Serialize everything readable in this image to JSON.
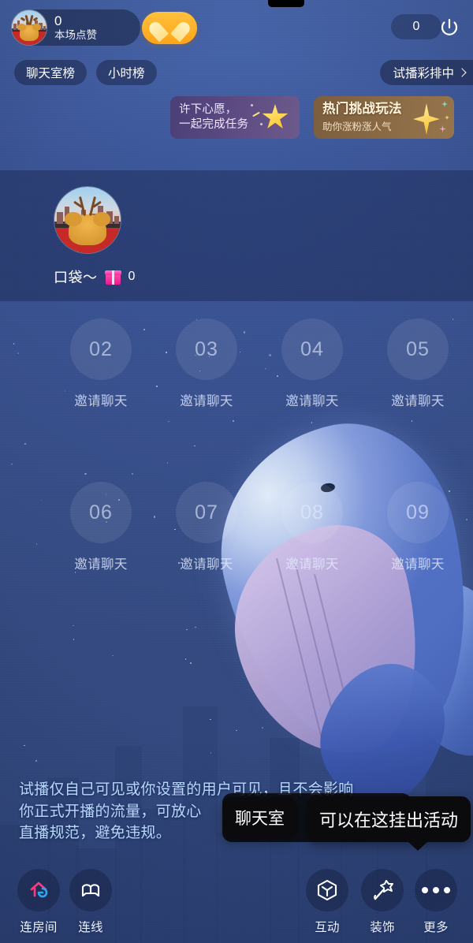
{
  "topbar": {
    "like_count": "0",
    "like_label": "本场点赞",
    "heart_icon": "heart-icon",
    "viewer_count": "0",
    "power_icon": "power-icon",
    "chips": [
      {
        "label": "聊天室榜"
      },
      {
        "label": "小时榜"
      }
    ],
    "rehearsal_label": "试播彩排中",
    "rehearsal_chevron": "chevron-right-icon"
  },
  "banners": [
    {
      "name": "wish-banner",
      "line1": "许下心愿，",
      "line2": "一起完成任务",
      "icon": "shooting-star-icon"
    },
    {
      "name": "challenge-banner",
      "title": "热门挑战玩法",
      "subtitle": "助你涨粉涨人气",
      "icon": "sparkle-star-icon"
    }
  ],
  "host": {
    "name": "口袋～",
    "gift_icon": "gift-box-icon",
    "gift_count": "0",
    "avatar_icon": "teddy-bear-avatar"
  },
  "seats": {
    "row1": [
      {
        "number": "02",
        "label": "邀请聊天"
      },
      {
        "number": "03",
        "label": "邀请聊天"
      },
      {
        "number": "04",
        "label": "邀请聊天"
      },
      {
        "number": "05",
        "label": "邀请聊天"
      }
    ],
    "row2": [
      {
        "number": "06",
        "label": "邀请聊天"
      },
      {
        "number": "07",
        "label": "邀请聊天"
      },
      {
        "number": "08",
        "label": "邀请聊天"
      },
      {
        "number": "09",
        "label": "邀请聊天"
      }
    ]
  },
  "disclaimer": {
    "line1": "试播仅自己可见或你设置的用户可见，且不会影响",
    "line2": "你正式开播的流量，可放心",
    "line3": "直播规范，避免违规。"
  },
  "tooltips": {
    "back_label": "聊天室",
    "front_label": "可以在这挂出活动"
  },
  "bottombar": {
    "left": [
      {
        "label": "连房间",
        "icon": "house-link-icon"
      },
      {
        "label": "连线",
        "icon": "co-broadcast-icon"
      }
    ],
    "right": [
      {
        "label": "互动",
        "icon": "hexagon-interaction-icon"
      },
      {
        "label": "装饰",
        "icon": "magic-wand-icon"
      },
      {
        "label": "更多",
        "icon": "more-dots-icon"
      }
    ]
  },
  "colors": {
    "background": "#3a5394",
    "accent_orange": "#ffa417",
    "accent_pink": "#e8198e",
    "tooltip_bg": "#0b0b0d"
  }
}
